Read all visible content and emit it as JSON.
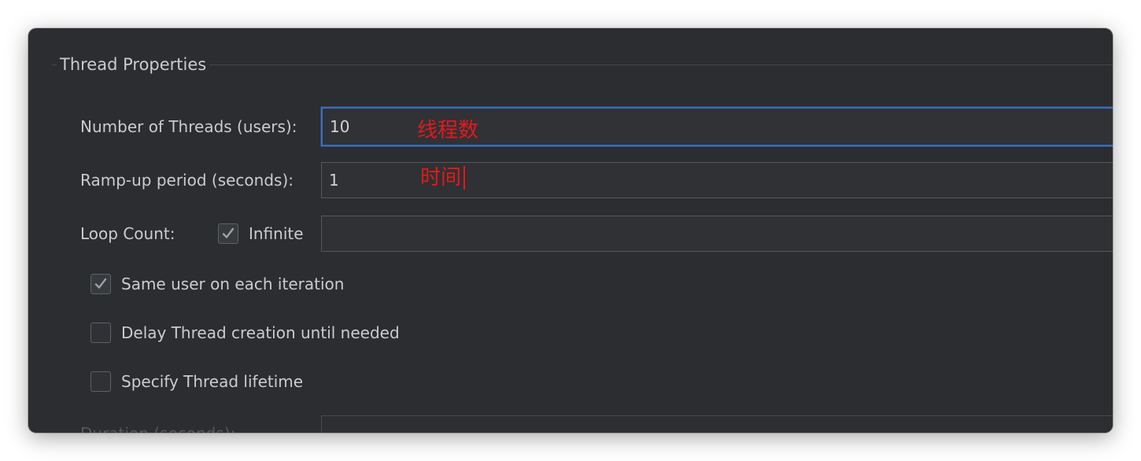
{
  "section": {
    "title": "Thread Properties"
  },
  "threads": {
    "label": "Number of Threads (users):",
    "value": "10",
    "annotation": "线程数"
  },
  "rampup": {
    "label": "Ramp-up period (seconds):",
    "value": "1",
    "annotation": "时间"
  },
  "loop": {
    "label": "Loop Count:",
    "infinite_label": "Infinite",
    "infinite_checked": true,
    "value": ""
  },
  "options": {
    "same_user": {
      "label": "Same user on each iteration",
      "checked": true
    },
    "delay_creation": {
      "label": "Delay Thread creation until needed",
      "checked": false
    },
    "specify_lifetime": {
      "label": "Specify Thread lifetime",
      "checked": false
    }
  },
  "duration": {
    "label": "Duration (seconds):",
    "value": ""
  },
  "colors": {
    "panel_bg": "#2b2d30",
    "text": "#c9ccd0",
    "focus_border": "#3f6eb3",
    "annotation": "#e3191c"
  }
}
